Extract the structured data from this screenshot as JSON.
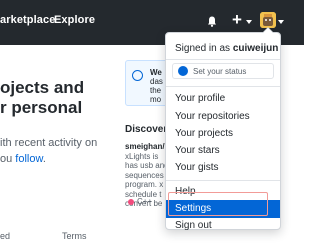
{
  "header": {
    "nav": [
      "arketplace",
      "Explore"
    ],
    "colors": {
      "bg": "#24292e",
      "text": "#ffffff"
    }
  },
  "icons": {
    "bell": "bell-icon",
    "plus": "plus-icon",
    "caret": "caret-down-icon",
    "avatar": "avatar-image"
  },
  "main": {
    "hero_lines": [
      "ojects and",
      "r personal"
    ],
    "hero_sub_prefix": "ith recent activity on",
    "hero_sub_prefix2": "ou ",
    "hero_sub_link": "follow",
    "hero_sub_suffix": ".",
    "notice": {
      "line1": "We",
      "line2": "das",
      "line3": "the",
      "line4": "mo"
    },
    "discover_title": "Discover",
    "repo": {
      "name": "smeighan/",
      "desc_lines": [
        "xLights is",
        "has usb and",
        "sequences",
        "program. x",
        "schedule t",
        "convert be"
      ]
    },
    "lang": "C++",
    "lang_extra": "",
    "footer": [
      "ed",
      "Terms"
    ]
  },
  "dropdown": {
    "signed_in_prefix": "Signed in as ",
    "username": "cuiweijun",
    "status": "Set your status",
    "items": [
      "Your profile",
      "Your repositories",
      "Your projects",
      "Your stars",
      "Your gists",
      "Help",
      "Settings",
      "Sign out"
    ],
    "active_color": "#0366d6"
  }
}
